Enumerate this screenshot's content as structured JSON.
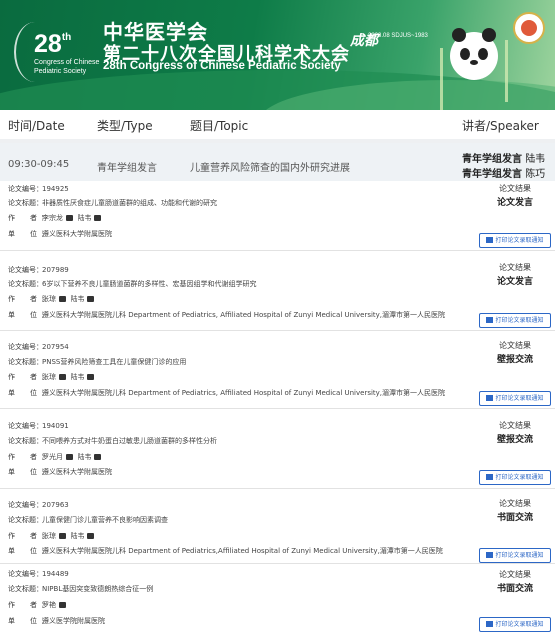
{
  "banner": {
    "number": "28",
    "number_sup": "th",
    "english_small": "Congress of Chinese Pediatric Society",
    "society_cn": "中华医学会",
    "title_cn": "第二十八次全国儿科学术大会",
    "title_en": "28th Congress of Chinese Pediatric Society",
    "calligraphy": "成都",
    "dates": "2023.08 SDJUS~1983"
  },
  "columns": {
    "time": "时间/Date",
    "type": "类型/Type",
    "topic": "题目/Topic",
    "speaker": "讲者/Speaker"
  },
  "session": {
    "time": "09:30-09:45",
    "type": "青年学组发言",
    "topic": "儿童营养风险筛查的国内外研究进展",
    "speakers": [
      {
        "role": "青年学组发言",
        "name": "陆韦"
      },
      {
        "role": "青年学组发言",
        "name": "陈巧玲"
      }
    ]
  },
  "labels": {
    "id": "论文编号：",
    "title": "论文标题：",
    "author": "作　者：",
    "unit": "单　位：",
    "result": "论文结果",
    "print": "打印论文录取通知"
  },
  "papers": [
    {
      "id": "194925",
      "title": "非器质性厌食症儿童肠道菌群的组成、功能和代谢的研究",
      "authors": [
        "李宗龙",
        "陆韦"
      ],
      "unit": "遵义医科大学附属医院",
      "result": "论文发言"
    },
    {
      "id": "207989",
      "title": "6岁以下营养不良儿童肠道菌群的多样性、宏基因组学和代谢组学研究",
      "authors": [
        "张琼",
        "陆韦"
      ],
      "unit": "遵义医科大学附属医院儿科 Department of Pediatrics, Affiliated Hospital of Zunyi Medical University,湄潭市第一人民医院",
      "result": "论文发言"
    },
    {
      "id": "207954",
      "title": "PNSS营养风险筛查工具在儿童保健门诊的应用",
      "authors": [
        "张琼",
        "陆韦"
      ],
      "unit": "遵义医科大学附属医院儿科 Department of Pediatrics, Affiliated Hospital of Zunyi Medical University,湄潭市第一人民医院",
      "result": "壁报交流"
    },
    {
      "id": "194091",
      "title": "不同喂养方式对牛奶蛋白过敏患儿肠道菌群的多样性分析",
      "authors": [
        "罗光月",
        "陆韦"
      ],
      "unit": "遵义医科大学附属医院",
      "result": "壁报交流"
    },
    {
      "id": "207963",
      "title": "儿童保健门诊儿童营养不良影响因素调查",
      "authors": [
        "张琼",
        "陆韦"
      ],
      "unit": "遵义医科大学附属医院儿科 Department of Pediatrics,Affiliated Hospital of Zunyi Medical University,湄潭市第一人民医院",
      "result": "书面交流"
    },
    {
      "id": "194489",
      "title": "NIPBL基因突变致德朗热综合征一例",
      "authors": [
        "罗艳"
      ],
      "unit": "遵义医学院附属医院",
      "result": "书面交流"
    }
  ]
}
